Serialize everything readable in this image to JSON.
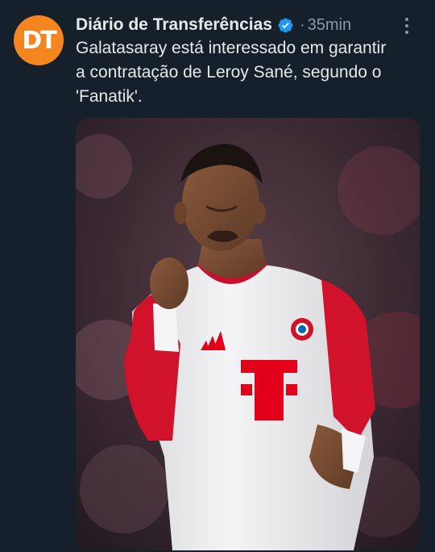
{
  "tweet": {
    "avatar": {
      "text": "DT",
      "color": "#f5861f",
      "icon": "avatar-logo"
    },
    "author": {
      "display_name": "Diário de Transferências",
      "verified": true,
      "verified_color": "#1d9bf0"
    },
    "separator": "·",
    "time": "35min",
    "more_icon": "more-options-icon",
    "text_lines": [
      "Galatasaray está interessado em garantir",
      "a contratação de Leroy Sané, segundo o",
      "'Fanatik'."
    ],
    "media": {
      "kind": "photo",
      "jersey_primary": "#ffffff",
      "jersey_accent": "#d0122a",
      "background": "#3a2a30"
    }
  },
  "theme": {
    "background": "#15202b",
    "text": "#e7e9ea",
    "muted": "#8b98a5"
  }
}
